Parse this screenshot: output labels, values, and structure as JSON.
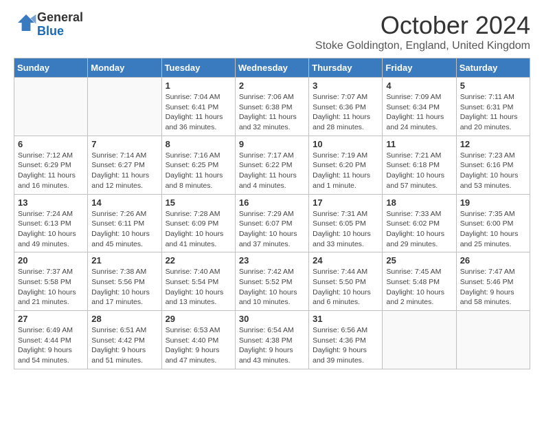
{
  "header": {
    "logo_general": "General",
    "logo_blue": "Blue",
    "month_title": "October 2024",
    "subtitle": "Stoke Goldington, England, United Kingdom"
  },
  "days_of_week": [
    "Sunday",
    "Monday",
    "Tuesday",
    "Wednesday",
    "Thursday",
    "Friday",
    "Saturday"
  ],
  "weeks": [
    [
      {
        "day": "",
        "info": ""
      },
      {
        "day": "",
        "info": ""
      },
      {
        "day": "1",
        "info": "Sunrise: 7:04 AM\nSunset: 6:41 PM\nDaylight: 11 hours and 36 minutes."
      },
      {
        "day": "2",
        "info": "Sunrise: 7:06 AM\nSunset: 6:38 PM\nDaylight: 11 hours and 32 minutes."
      },
      {
        "day": "3",
        "info": "Sunrise: 7:07 AM\nSunset: 6:36 PM\nDaylight: 11 hours and 28 minutes."
      },
      {
        "day": "4",
        "info": "Sunrise: 7:09 AM\nSunset: 6:34 PM\nDaylight: 11 hours and 24 minutes."
      },
      {
        "day": "5",
        "info": "Sunrise: 7:11 AM\nSunset: 6:31 PM\nDaylight: 11 hours and 20 minutes."
      }
    ],
    [
      {
        "day": "6",
        "info": "Sunrise: 7:12 AM\nSunset: 6:29 PM\nDaylight: 11 hours and 16 minutes."
      },
      {
        "day": "7",
        "info": "Sunrise: 7:14 AM\nSunset: 6:27 PM\nDaylight: 11 hours and 12 minutes."
      },
      {
        "day": "8",
        "info": "Sunrise: 7:16 AM\nSunset: 6:25 PM\nDaylight: 11 hours and 8 minutes."
      },
      {
        "day": "9",
        "info": "Sunrise: 7:17 AM\nSunset: 6:22 PM\nDaylight: 11 hours and 4 minutes."
      },
      {
        "day": "10",
        "info": "Sunrise: 7:19 AM\nSunset: 6:20 PM\nDaylight: 11 hours and 1 minute."
      },
      {
        "day": "11",
        "info": "Sunrise: 7:21 AM\nSunset: 6:18 PM\nDaylight: 10 hours and 57 minutes."
      },
      {
        "day": "12",
        "info": "Sunrise: 7:23 AM\nSunset: 6:16 PM\nDaylight: 10 hours and 53 minutes."
      }
    ],
    [
      {
        "day": "13",
        "info": "Sunrise: 7:24 AM\nSunset: 6:13 PM\nDaylight: 10 hours and 49 minutes."
      },
      {
        "day": "14",
        "info": "Sunrise: 7:26 AM\nSunset: 6:11 PM\nDaylight: 10 hours and 45 minutes."
      },
      {
        "day": "15",
        "info": "Sunrise: 7:28 AM\nSunset: 6:09 PM\nDaylight: 10 hours and 41 minutes."
      },
      {
        "day": "16",
        "info": "Sunrise: 7:29 AM\nSunset: 6:07 PM\nDaylight: 10 hours and 37 minutes."
      },
      {
        "day": "17",
        "info": "Sunrise: 7:31 AM\nSunset: 6:05 PM\nDaylight: 10 hours and 33 minutes."
      },
      {
        "day": "18",
        "info": "Sunrise: 7:33 AM\nSunset: 6:02 PM\nDaylight: 10 hours and 29 minutes."
      },
      {
        "day": "19",
        "info": "Sunrise: 7:35 AM\nSunset: 6:00 PM\nDaylight: 10 hours and 25 minutes."
      }
    ],
    [
      {
        "day": "20",
        "info": "Sunrise: 7:37 AM\nSunset: 5:58 PM\nDaylight: 10 hours and 21 minutes."
      },
      {
        "day": "21",
        "info": "Sunrise: 7:38 AM\nSunset: 5:56 PM\nDaylight: 10 hours and 17 minutes."
      },
      {
        "day": "22",
        "info": "Sunrise: 7:40 AM\nSunset: 5:54 PM\nDaylight: 10 hours and 13 minutes."
      },
      {
        "day": "23",
        "info": "Sunrise: 7:42 AM\nSunset: 5:52 PM\nDaylight: 10 hours and 10 minutes."
      },
      {
        "day": "24",
        "info": "Sunrise: 7:44 AM\nSunset: 5:50 PM\nDaylight: 10 hours and 6 minutes."
      },
      {
        "day": "25",
        "info": "Sunrise: 7:45 AM\nSunset: 5:48 PM\nDaylight: 10 hours and 2 minutes."
      },
      {
        "day": "26",
        "info": "Sunrise: 7:47 AM\nSunset: 5:46 PM\nDaylight: 9 hours and 58 minutes."
      }
    ],
    [
      {
        "day": "27",
        "info": "Sunrise: 6:49 AM\nSunset: 4:44 PM\nDaylight: 9 hours and 54 minutes."
      },
      {
        "day": "28",
        "info": "Sunrise: 6:51 AM\nSunset: 4:42 PM\nDaylight: 9 hours and 51 minutes."
      },
      {
        "day": "29",
        "info": "Sunrise: 6:53 AM\nSunset: 4:40 PM\nDaylight: 9 hours and 47 minutes."
      },
      {
        "day": "30",
        "info": "Sunrise: 6:54 AM\nSunset: 4:38 PM\nDaylight: 9 hours and 43 minutes."
      },
      {
        "day": "31",
        "info": "Sunrise: 6:56 AM\nSunset: 4:36 PM\nDaylight: 9 hours and 39 minutes."
      },
      {
        "day": "",
        "info": ""
      },
      {
        "day": "",
        "info": ""
      }
    ]
  ]
}
